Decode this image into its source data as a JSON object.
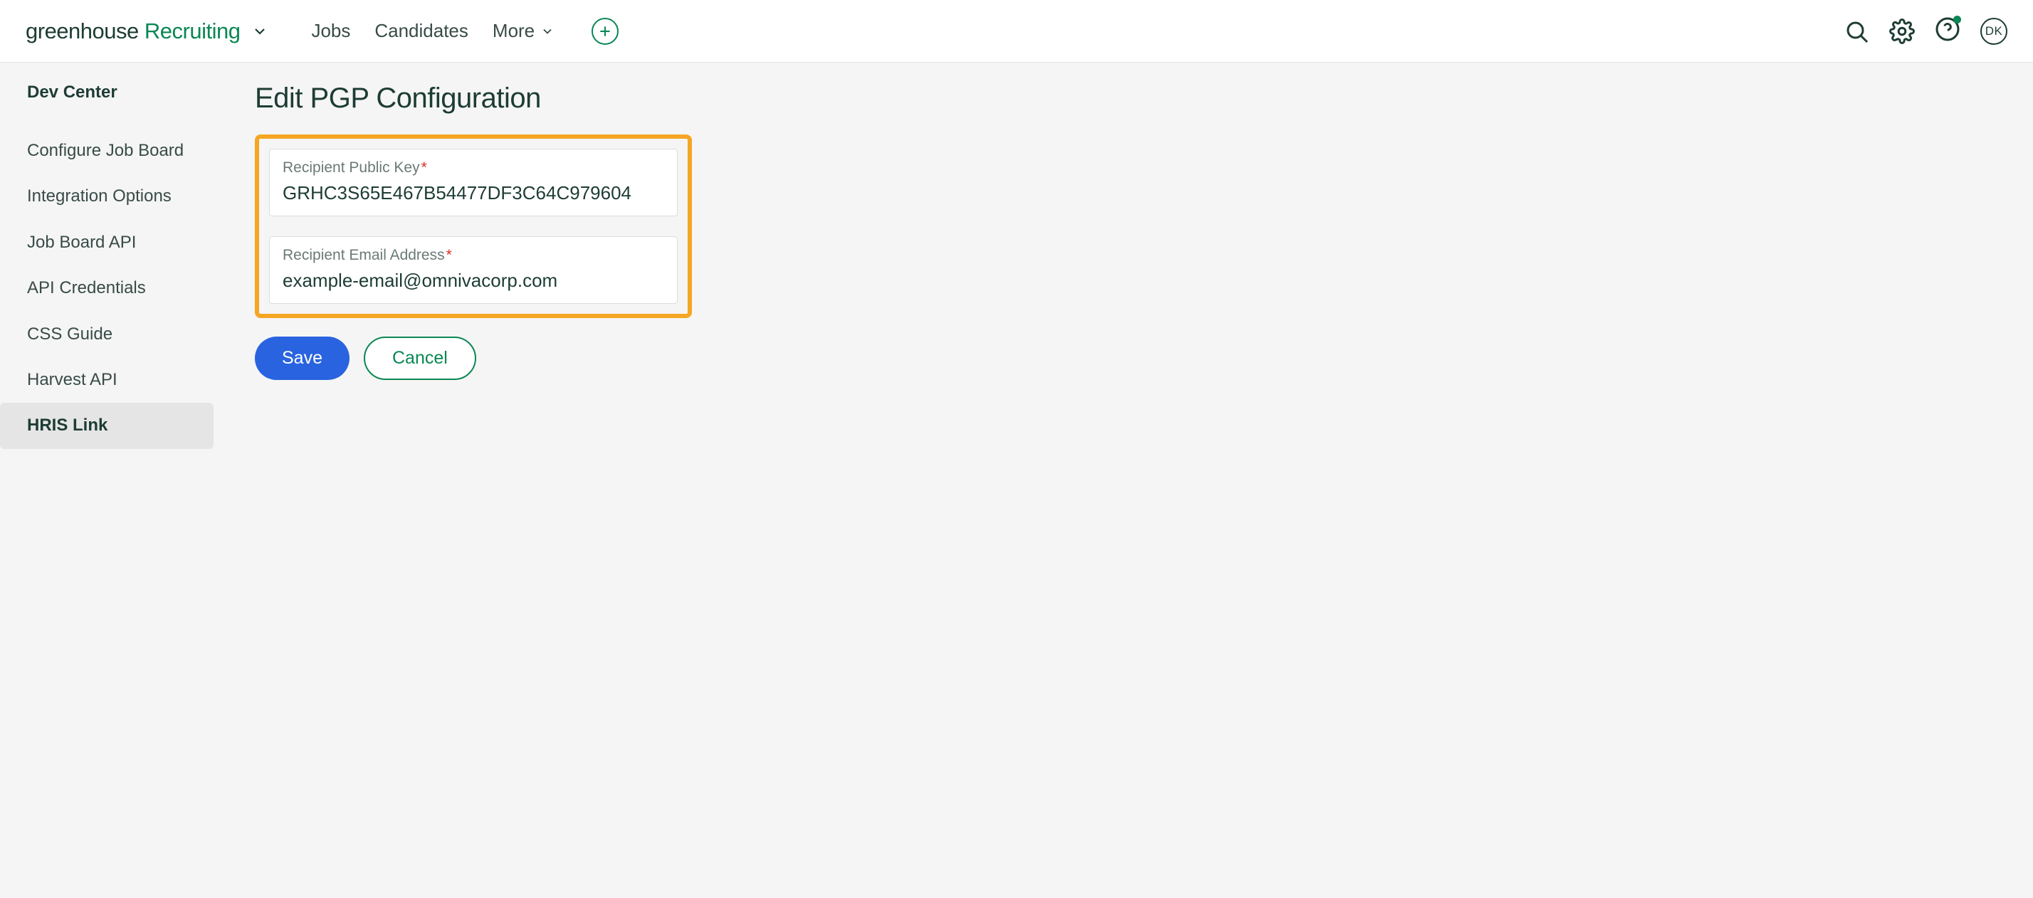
{
  "header": {
    "brand_part1": "greenhouse",
    "brand_part2": "Recruiting",
    "nav": {
      "jobs": "Jobs",
      "candidates": "Candidates",
      "more": "More"
    },
    "avatar_initials": "DK"
  },
  "sidebar": {
    "title": "Dev Center",
    "items": [
      "Configure Job Board",
      "Integration Options",
      "Job Board API",
      "API Credentials",
      "CSS Guide",
      "Harvest API",
      "HRIS Link"
    ]
  },
  "main": {
    "title": "Edit PGP Configuration",
    "fields": {
      "public_key": {
        "label": "Recipient Public Key",
        "value": "GRHC3S65E467B54477DF3C64C979604"
      },
      "email": {
        "label": "Recipient Email Address",
        "value": "example-email@omnivacorp.com"
      }
    },
    "actions": {
      "save": "Save",
      "cancel": "Cancel"
    }
  }
}
